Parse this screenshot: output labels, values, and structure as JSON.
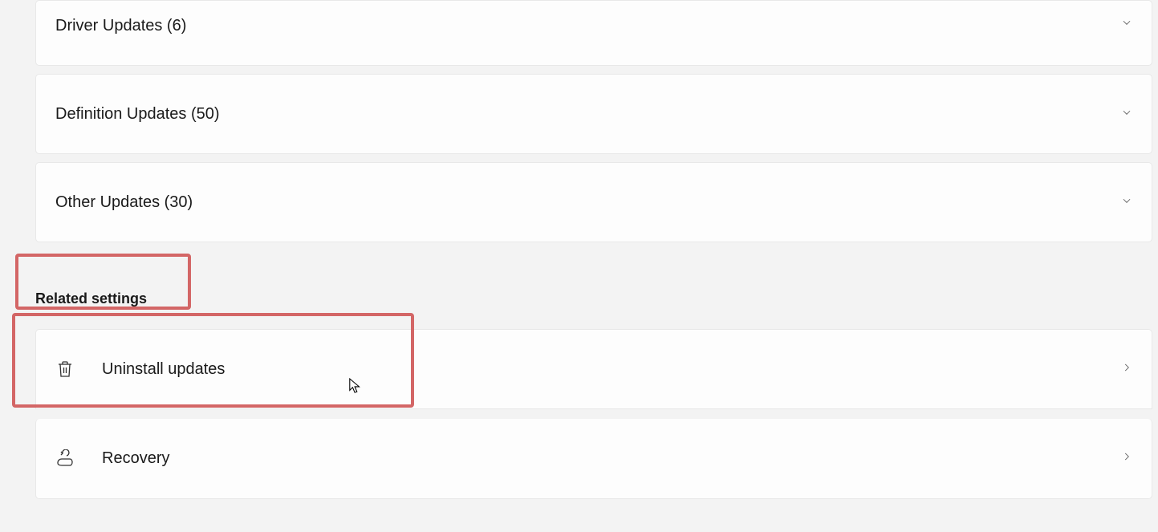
{
  "updates": [
    {
      "label": "Driver Updates (6)"
    },
    {
      "label": "Definition Updates (50)"
    },
    {
      "label": "Other Updates (30)"
    }
  ],
  "related_heading": "Related settings",
  "related": [
    {
      "label": "Uninstall updates"
    },
    {
      "label": "Recovery"
    }
  ]
}
